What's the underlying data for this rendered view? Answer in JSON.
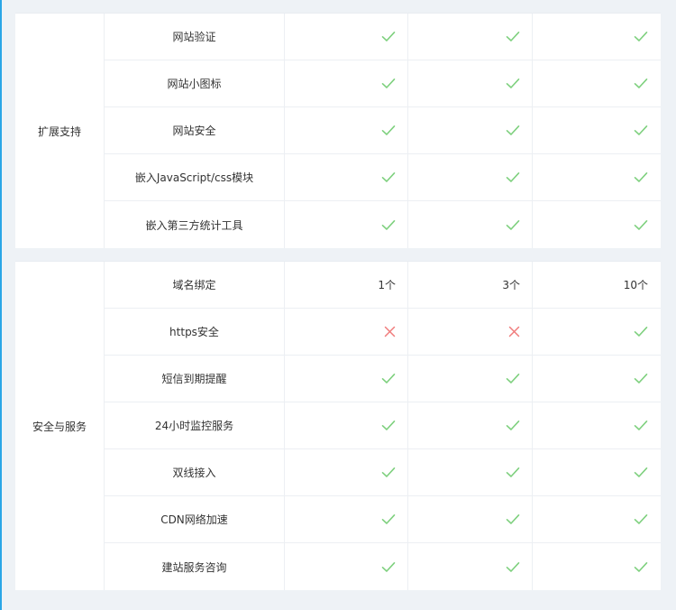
{
  "sections": [
    {
      "category": "扩展支持",
      "rows": [
        {
          "feature": "网站验证",
          "values": [
            {
              "type": "check"
            },
            {
              "type": "check"
            },
            {
              "type": "check"
            }
          ]
        },
        {
          "feature": "网站小图标",
          "values": [
            {
              "type": "check"
            },
            {
              "type": "check"
            },
            {
              "type": "check"
            }
          ]
        },
        {
          "feature": "网站安全",
          "values": [
            {
              "type": "check"
            },
            {
              "type": "check"
            },
            {
              "type": "check"
            }
          ]
        },
        {
          "feature": "嵌入JavaScript/css模块",
          "values": [
            {
              "type": "check"
            },
            {
              "type": "check"
            },
            {
              "type": "check"
            }
          ]
        },
        {
          "feature": "嵌入第三方统计工具",
          "values": [
            {
              "type": "check"
            },
            {
              "type": "check"
            },
            {
              "type": "check"
            }
          ]
        }
      ]
    },
    {
      "category": "安全与服务",
      "rows": [
        {
          "feature": "域名绑定",
          "values": [
            {
              "type": "text",
              "text": "1个"
            },
            {
              "type": "text",
              "text": "3个"
            },
            {
              "type": "text",
              "text": "10个"
            }
          ]
        },
        {
          "feature": "https安全",
          "values": [
            {
              "type": "cross"
            },
            {
              "type": "cross"
            },
            {
              "type": "check"
            }
          ]
        },
        {
          "feature": "短信到期提醒",
          "values": [
            {
              "type": "check"
            },
            {
              "type": "check"
            },
            {
              "type": "check"
            }
          ]
        },
        {
          "feature": "24小时监控服务",
          "values": [
            {
              "type": "check"
            },
            {
              "type": "check"
            },
            {
              "type": "check"
            }
          ]
        },
        {
          "feature": "双线接入",
          "values": [
            {
              "type": "check"
            },
            {
              "type": "check"
            },
            {
              "type": "check"
            }
          ]
        },
        {
          "feature": "CDN网络加速",
          "values": [
            {
              "type": "check"
            },
            {
              "type": "check"
            },
            {
              "type": "check"
            }
          ]
        },
        {
          "feature": "建站服务咨询",
          "values": [
            {
              "type": "check"
            },
            {
              "type": "check"
            },
            {
              "type": "check"
            }
          ]
        }
      ]
    }
  ],
  "icons": {
    "check": "check-icon",
    "cross": "cross-icon"
  },
  "colors": {
    "check": "#7ed07e",
    "cross": "#f07c7c",
    "accent": "#2aa6e6",
    "page_bg": "#eef2f6"
  }
}
